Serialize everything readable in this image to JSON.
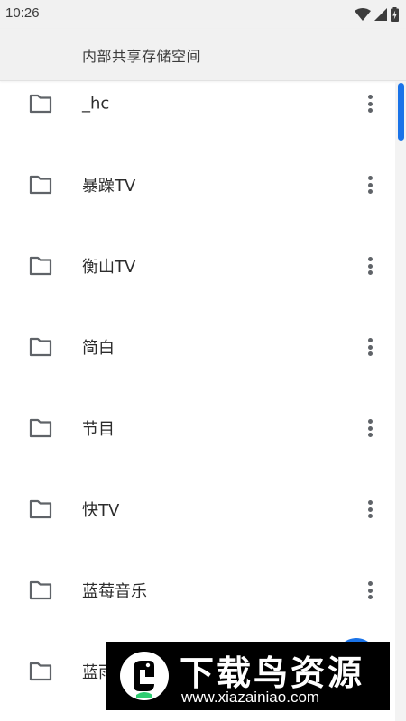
{
  "status_bar": {
    "time": "10:26",
    "icons": [
      "wifi-icon",
      "cellular-signal-icon",
      "battery-charging-icon"
    ]
  },
  "header": {
    "title": "内部共享存储空间"
  },
  "folders": [
    {
      "name": "_hc"
    },
    {
      "name": "暴躁TV"
    },
    {
      "name": "衡山TV"
    },
    {
      "name": "简白"
    },
    {
      "name": "节目"
    },
    {
      "name": "快TV"
    },
    {
      "name": "蓝莓音乐"
    },
    {
      "name": "蓝雨"
    }
  ],
  "row_icons": {
    "folder": "folder-outline-icon",
    "menu": "more-vert-icon"
  },
  "watermark": {
    "title": "下载鸟资源",
    "url": "www.xiazainiao.com"
  },
  "colors": {
    "accent": "#1a73e8",
    "icon_gray": "#5f6368",
    "header_bg": "#f1f1f1",
    "watermark_bg": "#000000",
    "watermark_green": "#2ecc71"
  }
}
